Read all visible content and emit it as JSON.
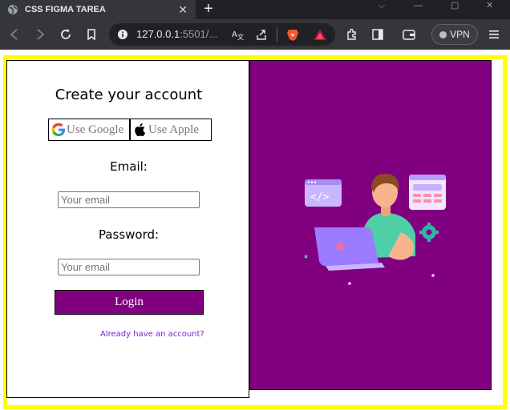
{
  "browser": {
    "tab_title": "CSS FIGMA TAREA",
    "tab_close": "✕",
    "new_tab": "+",
    "url_host": "127.0.0.1",
    "url_rest": ":5501/...",
    "vpn_label": "VPN",
    "window_controls": [
      "⌵",
      "—",
      "▢",
      "✕"
    ]
  },
  "form": {
    "title": "Create your account",
    "google_label": "Use Google",
    "apple_label": "Use Apple",
    "email_label": "Email:",
    "email_placeholder": "Your email",
    "password_label": "Password:",
    "password_placeholder": "Your email",
    "login_label": "Login",
    "have_account": "Already have an account?"
  },
  "colors": {
    "accent": "#800080",
    "frame": "#ffff00",
    "link": "#7a1fd1"
  },
  "icons": [
    "globe-icon",
    "back-icon",
    "forward-icon",
    "reload-icon",
    "bookmark-icon",
    "info-icon",
    "translate-icon",
    "share-icon",
    "brave-icon",
    "rewards-icon",
    "extensions-icon",
    "sidebar-icon",
    "wallet-icon",
    "menu-icon",
    "google-icon",
    "apple-icon"
  ]
}
